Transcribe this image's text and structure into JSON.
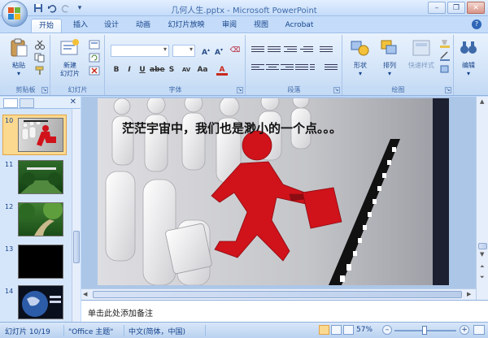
{
  "window": {
    "title": "几何人生.pptx - Microsoft PowerPoint"
  },
  "qat": {
    "save_icon": "save-icon",
    "undo_icon": "undo-icon",
    "redo_icon": "redo-icon"
  },
  "tabs": [
    {
      "label": "开始",
      "active": true
    },
    {
      "label": "插入"
    },
    {
      "label": "设计"
    },
    {
      "label": "动画"
    },
    {
      "label": "幻灯片放映"
    },
    {
      "label": "审阅"
    },
    {
      "label": "视图"
    },
    {
      "label": "Acrobat"
    }
  ],
  "ribbon": {
    "clipboard": {
      "label": "剪贴板",
      "paste": "粘贴"
    },
    "slides": {
      "label": "幻灯片",
      "new_slide_line1": "新建",
      "new_slide_line2": "幻灯片"
    },
    "font": {
      "label": "字体"
    },
    "paragraph": {
      "label": "段落"
    },
    "drawing": {
      "label": "绘图",
      "shapes": "形状",
      "arrange": "排列",
      "quick_styles": "快速样式"
    },
    "editing": {
      "label": "编辑"
    }
  },
  "slide_panel": {
    "slides": [
      {
        "number": "10"
      },
      {
        "number": "11"
      },
      {
        "number": "12"
      },
      {
        "number": "13"
      },
      {
        "number": "14"
      }
    ]
  },
  "slide": {
    "caption": "茫茫宇宙中，我们也是渺小的一个点。。。"
  },
  "notes": {
    "placeholder": "单击此处添加备注"
  },
  "status": {
    "slide_indicator": "幻灯片 10/19",
    "theme": "\"Office 主题\"",
    "language": "中文(简体，中国)",
    "zoom": "57%"
  },
  "colors": {
    "accent": "#15428b",
    "figure_red": "#d0121a",
    "selected_thumb": "#fbd98f"
  }
}
